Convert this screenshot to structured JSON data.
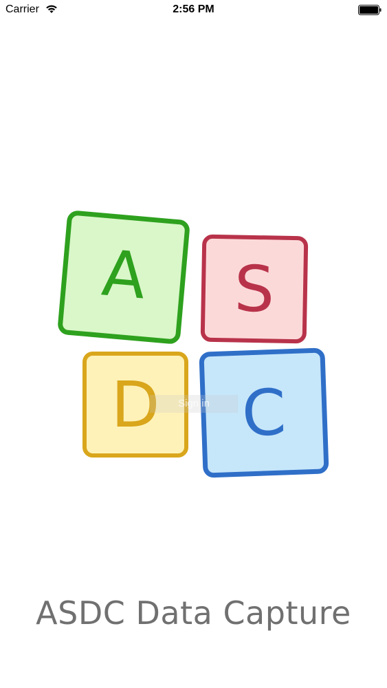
{
  "status_bar": {
    "carrier": "Carrier",
    "time": "2:56 PM",
    "wifi_icon": "wifi-icon",
    "battery_icon": "battery-icon"
  },
  "logo": {
    "blocks": [
      {
        "letter": "A",
        "color": "#2EA11E",
        "fill": "#D9F7C9"
      },
      {
        "letter": "S",
        "color": "#B8334A",
        "fill": "#FCD9D9"
      },
      {
        "letter": "D",
        "color": "#D9A61C",
        "fill": "#FFF2B8"
      },
      {
        "letter": "C",
        "color": "#2F6FC8",
        "fill": "#C6E6FA"
      }
    ]
  },
  "signin": {
    "label": "Sign in"
  },
  "app_name": "ASDC Data Capture"
}
